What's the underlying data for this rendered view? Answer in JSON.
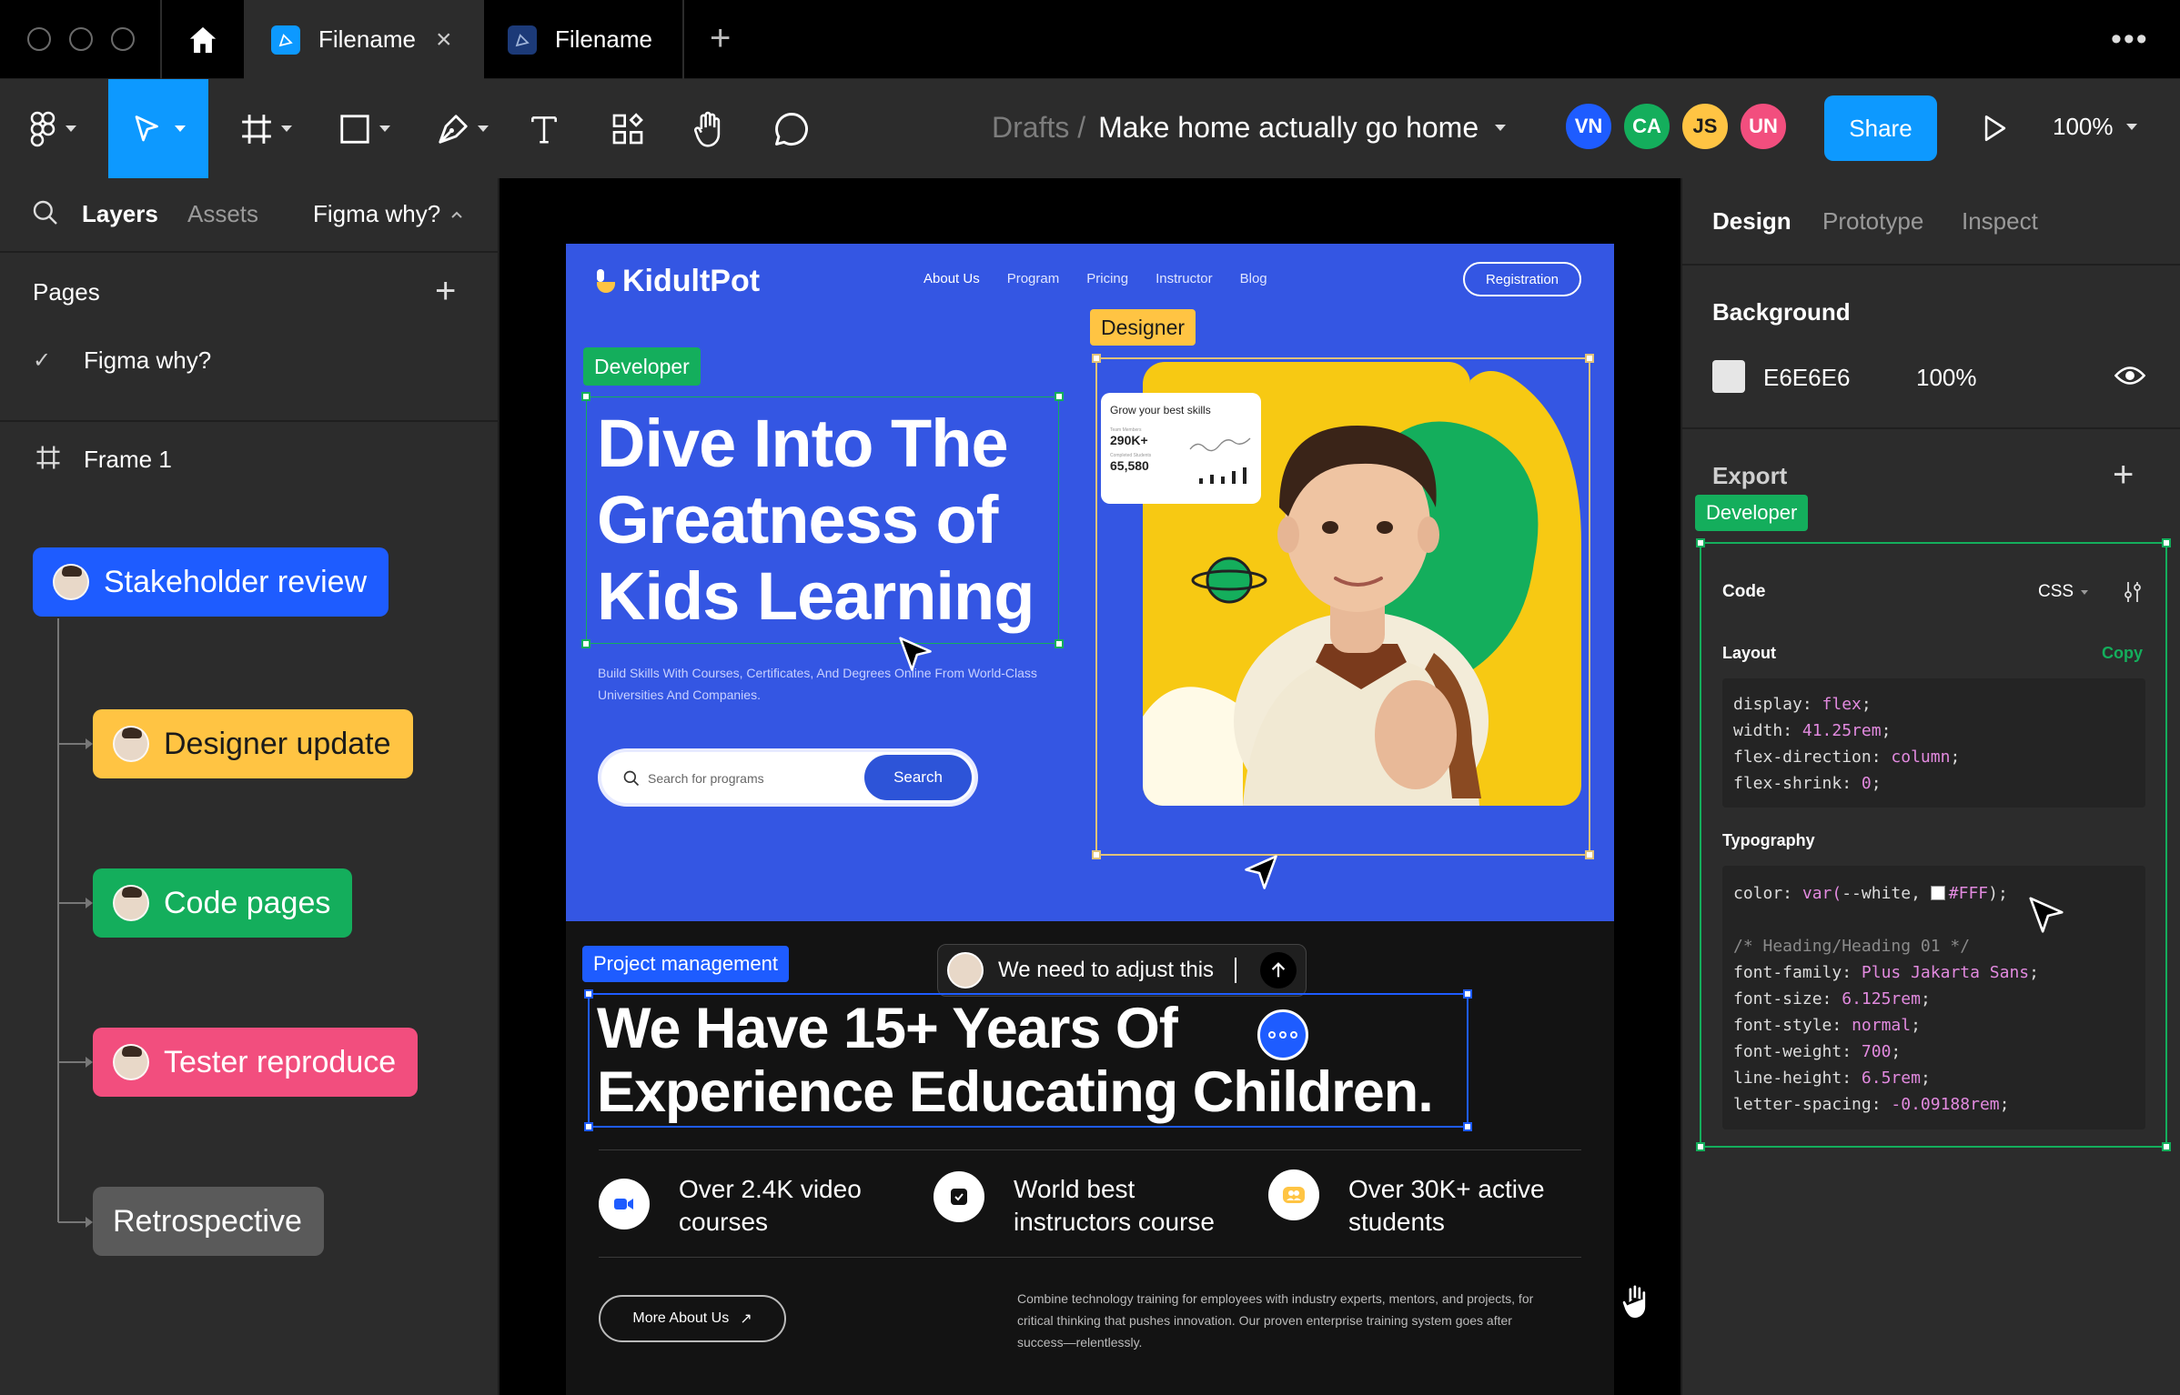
{
  "titlebar": {
    "tabs": [
      {
        "label": "Filename",
        "active": true
      },
      {
        "label": "Filename",
        "active": false
      }
    ]
  },
  "toolbar": {
    "breadcrumb_parent": "Drafts /",
    "file_title": "Make home actually go home",
    "avatars": [
      {
        "initials": "VN",
        "color": "#1e5cff"
      },
      {
        "initials": "CA",
        "color": "#14ae5c"
      },
      {
        "initials": "JS",
        "color": "#ffc443"
      },
      {
        "initials": "UN",
        "color": "#f24e7e"
      }
    ],
    "share_label": "Share",
    "zoom": "100%"
  },
  "left_panel": {
    "tabs": {
      "layers": "Layers",
      "assets": "Assets"
    },
    "page_select": "Figma why?",
    "pages_title": "Pages",
    "pages": [
      "Figma why?"
    ],
    "frame_name": "Frame 1",
    "flow": [
      {
        "label": "Stakeholder review",
        "color": "#1e5cff"
      },
      {
        "label": "Designer update",
        "color": "#ffc443"
      },
      {
        "label": "Code pages",
        "color": "#14ae5c"
      },
      {
        "label": "Tester reproduce",
        "color": "#f24e7e"
      },
      {
        "label": "Retrospective",
        "color": "#5a5a5a"
      }
    ]
  },
  "site": {
    "brand": "KidultPot",
    "nav": [
      "About Us",
      "Program",
      "Pricing",
      "Instructor",
      "Blog"
    ],
    "registration": "Registration",
    "headline_lines": [
      "Dive Into The",
      "Greatness of",
      "Kids Learning"
    ],
    "subtext_lines": [
      "Build Skills With Courses, Certificates, And Degrees Online From World-Class",
      "Universities And Companies."
    ],
    "search_placeholder": "Search for programs",
    "search_button": "Search",
    "stats_card": {
      "title": "Grow your best skills",
      "label1": "Team Members",
      "value1": "290K+",
      "label2": "Completed Students",
      "value2": "65,580"
    },
    "section_title_lines": [
      "We Have 15+ Years Of",
      "Experience Educating Children."
    ],
    "features": [
      {
        "line1": "Over 2.4K video",
        "line2": "courses"
      },
      {
        "line1": "World best",
        "line2": "instructors course"
      },
      {
        "line1": "Over 30K+ active",
        "line2": "students"
      }
    ],
    "more_button": "More About Us",
    "paragraph_lines": [
      "Combine technology training for employees with industry experts, mentors, and projects, for",
      "critical thinking that pushes innovation. Our proven enterprise training system goes after",
      "success—relentlessly."
    ]
  },
  "canvas_labels": {
    "designer": "Designer",
    "developer": "Developer",
    "project_management": "Project management",
    "comment": "We need to adjust this"
  },
  "right_panel": {
    "tabs": {
      "design": "Design",
      "prototype": "Prototype",
      "inspect": "Inspect"
    },
    "background_title": "Background",
    "bg_hex": "E6E6E6",
    "bg_opacity": "100%",
    "export_title": "Export",
    "developer_tag": "Developer",
    "code_title": "Code",
    "code_lang": "CSS",
    "layout_title": "Layout",
    "copy_label": "Copy",
    "layout_code": [
      {
        "prop": "display",
        "val": "flex"
      },
      {
        "prop": "width",
        "val": "41.25rem"
      },
      {
        "prop": "flex-direction",
        "val": "column"
      },
      {
        "prop": "flex-shrink",
        "val": "0"
      }
    ],
    "typography_title": "Typography",
    "color_prefix": "color: ",
    "color_var": "var(",
    "color_var_name": "--white, ",
    "color_hex": "#FFF",
    "color_suffix": ");",
    "comment_line": "/* Heading/Heading 01 */",
    "typo_code": [
      {
        "prop": "font-family",
        "val": "Plus Jakarta Sans"
      },
      {
        "prop": "font-size",
        "val": "6.125rem"
      },
      {
        "prop": "font-style",
        "val": "normal"
      },
      {
        "prop": "font-weight",
        "val": "700"
      },
      {
        "prop": "line-height",
        "val": "6.5rem"
      },
      {
        "prop": "letter-spacing",
        "val": "-0.09188rem"
      }
    ]
  },
  "colors": {
    "blue": "#1e5cff",
    "green": "#14ae5c",
    "yellow": "#ffc443",
    "pink": "#f24e7e",
    "share": "#0d99ff",
    "hero_bg": "#3456e3"
  }
}
